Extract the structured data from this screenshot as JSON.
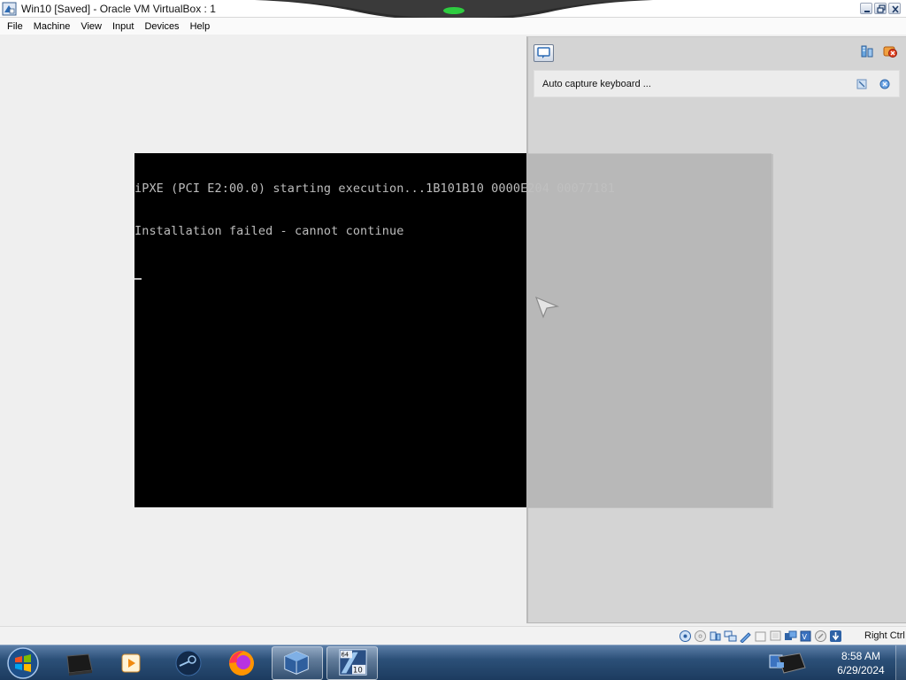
{
  "window": {
    "title": "Win10 [Saved] - Oracle VM VirtualBox : 1",
    "controls": [
      "minimize",
      "restore",
      "close"
    ]
  },
  "menubar": {
    "items": [
      "File",
      "Machine",
      "View",
      "Input",
      "Devices",
      "Help"
    ]
  },
  "console": {
    "lines": [
      "iPXE (PCI E2:00.0) starting execution...1B101B10 0000E204 00077181",
      "Installation failed - cannot continue"
    ]
  },
  "overlay": {
    "notice_text": "Auto capture keyboard ..."
  },
  "statusbar": {
    "host_key": "Right Ctrl",
    "icons": [
      "hard-disk-icon",
      "optical-drive-icon",
      "audio-icon",
      "network-icon",
      "usb-icon",
      "shared-folders-icon",
      "display-icon",
      "video-capture-icon",
      "cpu-icon",
      "mouse-integration-icon",
      "keyboard-icon"
    ]
  },
  "taskbar": {
    "apps": [
      "terminal-app",
      "media-player-app",
      "steam-app",
      "firefox-app",
      "virtualbox-app",
      "win10-vm-app"
    ],
    "vm_badge_top": "64",
    "vm_badge_bottom": "10",
    "time": "8:58 AM",
    "date": "6/29/2024"
  }
}
